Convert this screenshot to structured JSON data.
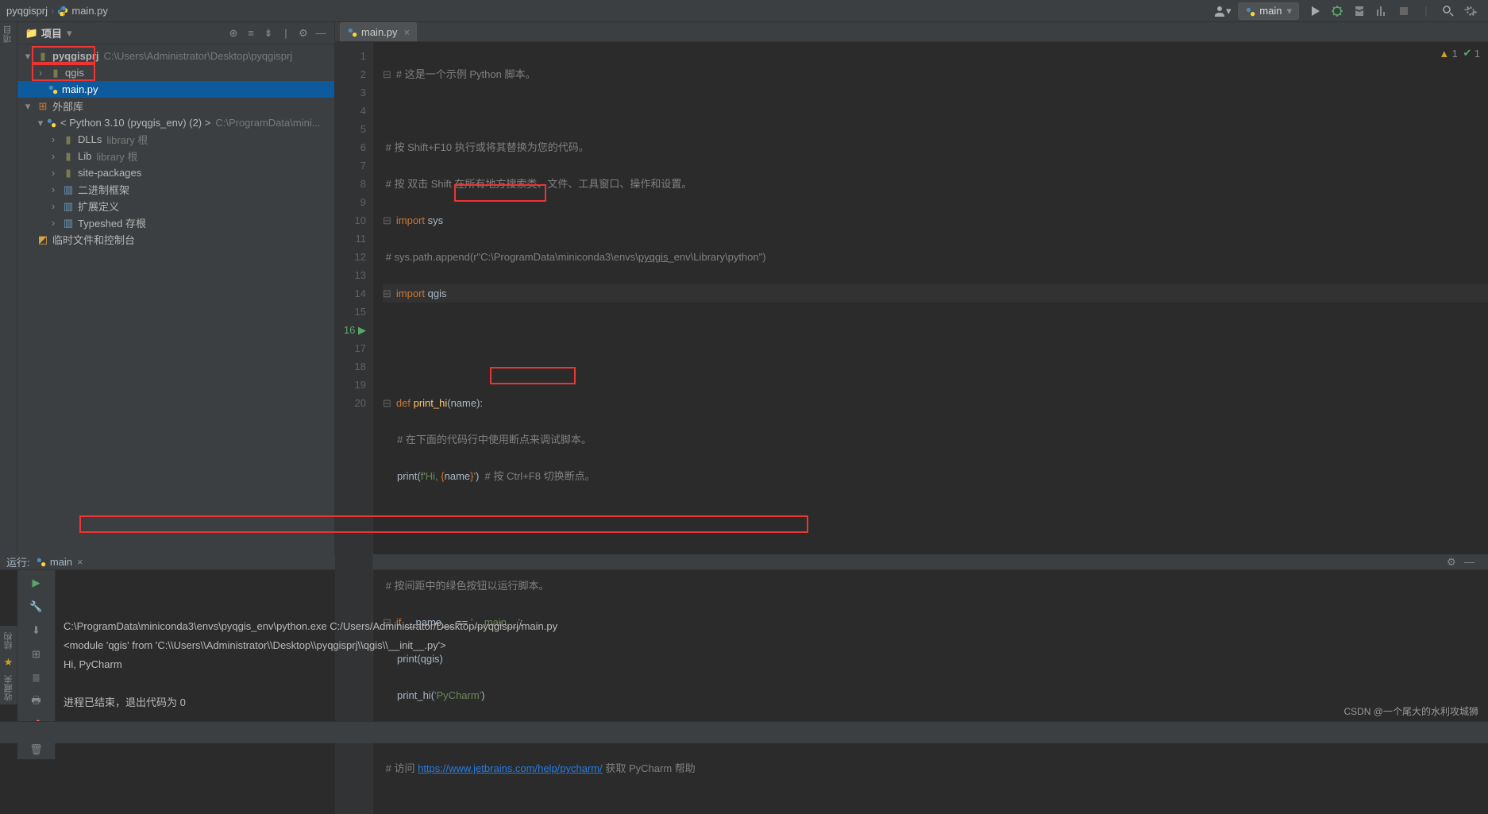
{
  "breadcrumb": {
    "project": "pyqgisprj",
    "file": "main.py"
  },
  "runConfig": "main",
  "projectPanel": {
    "title": "项目",
    "root": {
      "name": "pyqgisprj",
      "path": "C:\\Users\\Administrator\\Desktop\\pyqgisprj"
    },
    "qgisFolder": "qgis",
    "mainFile": "main.py",
    "extLib": "外部库",
    "pythonEnv": "< Python 3.10 (pyqgis_env) (2) >",
    "pythonEnvPath": "C:\\ProgramData\\mini...",
    "dlls": "DLLs",
    "libRoot": "library 根",
    "lib": "Lib",
    "libRoot2": "library 根",
    "sitePackages": "site-packages",
    "binFramework": "二进制框架",
    "extDef": "扩展定义",
    "typeshed": "Typeshed 存根",
    "scratches": "临时文件和控制台"
  },
  "editor": {
    "tab": "main.py",
    "lines": [
      "# 这是一个示例 Python 脚本。",
      "",
      "# 按 Shift+F10 执行或将其替换为您的代码。",
      "# 按 双击 Shift 在所有地方搜索类、文件、工具窗口、操作和设置。",
      "import sys",
      "# sys.path.append(r\"C:\\ProgramData\\miniconda3\\envs\\pyqgis_env\\Library\\python\")",
      "import qgis",
      "",
      "",
      "def print_hi(name):",
      "    # 在下面的代码行中使用断点来调试脚本。",
      "    print(f'Hi, {name}')  # 按 Ctrl+F8 切换断点。",
      "",
      "",
      "# 按间距中的绿色按钮以运行脚本。",
      "if __name__ == '__main__':",
      "    print(qgis)",
      "    print_hi('PyCharm')",
      "",
      "# 访问 https://www.jetbrains.com/help/pycharm/ 获取 PyCharm 帮助"
    ],
    "inspections": {
      "warn": "1",
      "ok": "1"
    }
  },
  "runPanel": {
    "title": "运行:",
    "cfg": "main",
    "console": [
      "C:\\ProgramData\\miniconda3\\envs\\pyqgis_env\\python.exe C:/Users/Administrator/Desktop/pyqgisprj/main.py",
      "<module 'qgis' from 'C:\\\\Users\\\\Administrator\\\\Desktop\\\\pyqgisprj\\\\qgis\\\\__init__.py'>",
      "Hi, PyCharm",
      "",
      "进程已结束，退出代码为 0"
    ]
  },
  "watermark": "CSDN @一个尾大的水利攻城狮",
  "sideLabels": {
    "project": "项目",
    "structure": "结构",
    "bookmarks": "收藏夹"
  }
}
